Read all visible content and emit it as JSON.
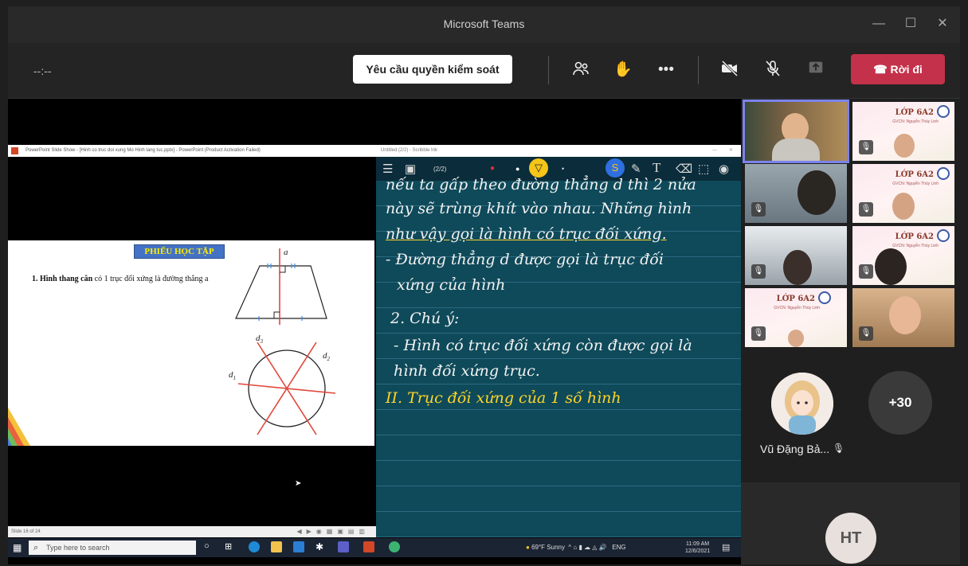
{
  "window": {
    "title": "Microsoft Teams"
  },
  "toolbar": {
    "timer": "--:--",
    "request_control_label": "Yêu cầu quyền kiểm soát",
    "leave_label": "Rời đi",
    "icons": [
      "people-icon",
      "raise-hand-icon",
      "more-icon",
      "camera-off-icon",
      "mic-off-icon",
      "share-icon"
    ]
  },
  "ppt": {
    "window_title": "PowerPoint Slide Show - [Hinh co truc doi xung Mo Hinh lang tuc.pptx] - PowerPoint (Product Activation Failed)",
    "slide_heading": "PHIẾU HỌC TẬP",
    "slide_item_bold": "1. Hình thang cân",
    "slide_item_rest": " có 1 trục đối xứng là đường thẳng a",
    "label_a": "a",
    "label_d1": "d",
    "label_d2": "d",
    "label_d3": "d",
    "status": "Slide 16 of 24"
  },
  "notes": {
    "window_title": "Untitled (2/2) - Scribble Ink",
    "page_indicator": "(2/2)",
    "lines": [
      "nếu ta gấp theo đường thẳng d thì 2 nửa",
      "này sẽ trùng khít vào nhau. Những hình",
      "như vậy gọi là hình có trục đối xứng.",
      "- Đường thẳng d được gọi là trục đối",
      "xứng của hình",
      "2. Chú ý:",
      "- Hình có trục đối xứng còn được gọi là",
      "hình đối xứng trục."
    ],
    "heading_yellow": "II. Trục đối xứng của 1 số hình"
  },
  "taskbar": {
    "search_placeholder": "Type here to search",
    "weather": "69°F Sunny",
    "lang": "ENG",
    "time": "11:09 AM",
    "date": "12/6/2021"
  },
  "gallery": {
    "class_label": "LỚP 6A2",
    "class_sub": "GVCN: Nguyễn Thùy Linh",
    "more_count": "+30",
    "participant_name": "Vũ Đặng Bả...",
    "initials": "HT"
  },
  "colors": {
    "leave": "#c4314b",
    "active_outline": "#7b83eb",
    "board": "#0f4a5a",
    "ink_yellow": "#ffd428"
  }
}
